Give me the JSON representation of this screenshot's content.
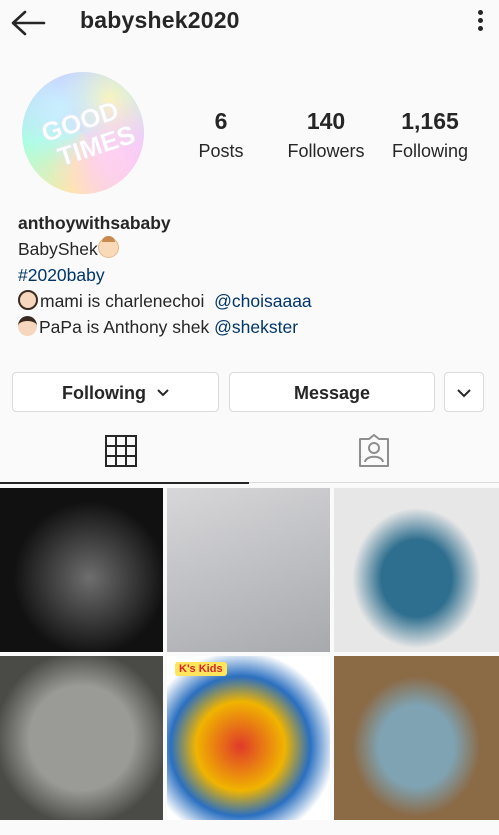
{
  "header": {
    "username": "babyshek2020",
    "back_icon": "arrow-left-icon",
    "menu_icon": "more-vertical-icon"
  },
  "profile": {
    "avatar_text": [
      "GOOD",
      "TIMES"
    ],
    "stats": [
      {
        "value": "6",
        "label": "Posts"
      },
      {
        "value": "140",
        "label": "Followers"
      },
      {
        "value": "1,165",
        "label": "Following"
      }
    ],
    "display_name": "anthoywithsababy",
    "bio": {
      "line1": "BabyShek",
      "hashtag": "#2020baby",
      "line3_text": "mami is charlenechoi",
      "line3_mention": "@choisaaaa",
      "line4_text": "PaPa is Anthony shek",
      "line4_mention": "@shekster"
    }
  },
  "actions": {
    "following": "Following",
    "message": "Message"
  },
  "tabs": [
    {
      "icon": "grid-icon"
    },
    {
      "icon": "tagged-person-icon"
    }
  ],
  "posts": [
    {
      "name": "ultrasound-photo",
      "colors": [
        "#111111",
        "#6e6e6e"
      ],
      "text": ""
    },
    {
      "name": "baby-onesies-photo",
      "colors": [
        "#d7d7da",
        "#a8a9ad"
      ],
      "text": ""
    },
    {
      "name": "baby-bibs-photo",
      "colors": [
        "#e7e7e7",
        "#2e6e8e"
      ],
      "text": ""
    },
    {
      "name": "grey-bodysuit-photo",
      "colors": [
        "#9a9a96",
        "#4a4a46"
      ],
      "text": ""
    },
    {
      "name": "kskids-toy-box-photo",
      "colors": [
        "#ffffff",
        "#e03a2a"
      ],
      "text": "K's Kids"
    },
    {
      "name": "blue-sleepsuit-photo",
      "colors": [
        "#8b6a46",
        "#7fa3b3"
      ],
      "text": ""
    }
  ]
}
